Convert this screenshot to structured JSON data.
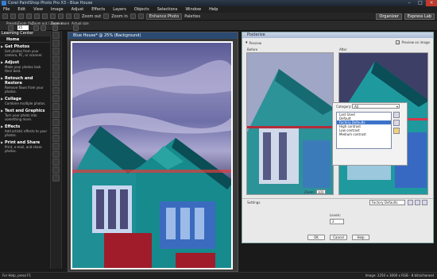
{
  "window": {
    "title": "Corel PaintShop Photo Pro X3 - Blue House"
  },
  "menu": [
    "File",
    "Edit",
    "View",
    "Image",
    "Adjust",
    "Effects",
    "Layers",
    "Objects",
    "Selections",
    "Window",
    "Help"
  ],
  "toolbar": {
    "zoom_out": "Zoom out",
    "zoom_in": "Zoom in",
    "enhance_photo": "Enhance Photo",
    "palettes": "Palettes",
    "organizer": "Organizer",
    "express_lab": "Express Lab"
  },
  "toolbar2": {
    "presets": "Presets",
    "zoom_label": "Zoom (%):",
    "zoom_value": "25",
    "zoom_out_in": "Zoom out / Zoom in",
    "zoom_more": "Zoom more",
    "actual_size": "Actual size"
  },
  "learning_center": {
    "title": "Learning Center",
    "home": "Home",
    "items": [
      {
        "title": "Get Photos",
        "desc": "Get photos from your camera, PC, or scanner."
      },
      {
        "title": "Adjust",
        "desc": "Make your photos look their best."
      },
      {
        "title": "Retouch and Restore",
        "desc": "Remove flaws from your photos."
      },
      {
        "title": "Collage",
        "desc": "Combine multiple photos."
      },
      {
        "title": "Text and Graphics",
        "desc": "Turn your photo into something more."
      },
      {
        "title": "Effects",
        "desc": "Add artistic effects to your photos."
      },
      {
        "title": "Print and Share",
        "desc": "Print, e-mail, and share photos."
      }
    ]
  },
  "document": {
    "title": "Blue House* @ 25% (Background)"
  },
  "dialog": {
    "title": "Posterize",
    "preview_label": "Preview",
    "preview_on_image": "Preview on image",
    "before": "Before",
    "after": "After",
    "category_label": "Category:",
    "category_value": "All",
    "presets": [
      "Last Used",
      "Default",
      "Factory Defaults",
      "High contrast",
      "Low contrast",
      "Medium contrast"
    ],
    "selected_preset": "Factory Defaults",
    "zoom_label": "Zoom:",
    "zoom_value": "100",
    "settings_label": "Settings",
    "settings_value": "Factory Defaults",
    "levels_label": "Levels:",
    "levels_value": "2",
    "ok": "OK",
    "cancel": "Cancel",
    "help": "Help"
  },
  "status": {
    "left": "For Help, press F1",
    "right": "Image: 2250 x 3000 x RGB - 8 bits/channel"
  }
}
